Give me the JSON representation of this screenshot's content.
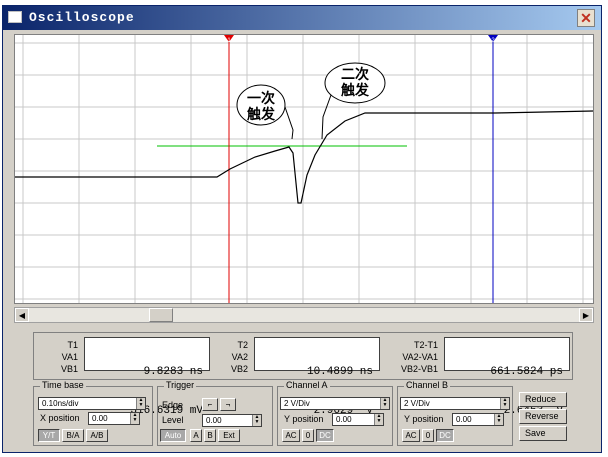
{
  "window": {
    "title": "Oscilloscope",
    "close_label": "✕"
  },
  "screen": {
    "annotation_first": [
      "一次",
      "触发"
    ],
    "annotation_second": [
      "二次",
      "触发"
    ],
    "cursor1_label": "1",
    "cursor2_label": "2",
    "colors": {
      "grid": "#c0c0c0",
      "trace": "#000000",
      "trigger_line": "#00c000",
      "cursor1": "#e00000",
      "cursor2": "#0000c0"
    }
  },
  "readouts": {
    "t1": {
      "labels": [
        "T1",
        "VA1",
        "VB1"
      ],
      "lines": [
        "9.8283 ns",
        "316.6319 mV"
      ]
    },
    "t2": {
      "labels": [
        "T2",
        "VA2",
        "VB2"
      ],
      "lines": [
        "10.4899 ns",
        "2.9629  V"
      ]
    },
    "delta": {
      "labels": [
        "T2-T1",
        "VA2-VA1",
        "VB2-VB1"
      ],
      "lines": [
        "661.5824 ps",
        "2.6463  V"
      ]
    }
  },
  "timebase": {
    "title": "Time base",
    "scale": "0.10ns/div",
    "xpos_label": "X position",
    "xpos": "0.00",
    "buttons": [
      "Y/T",
      "B/A",
      "A/B"
    ]
  },
  "trigger": {
    "title": "Trigger",
    "edge_label": "Edge",
    "level_label": "Level",
    "level": "0.00",
    "buttons": [
      "Auto",
      "A",
      "B",
      "Ext"
    ]
  },
  "channel_a": {
    "title": "Channel A",
    "scale": "2 V/Div",
    "ypos_label": "Y position",
    "ypos": "0.00",
    "buttons": [
      "AC",
      "0",
      "DC"
    ]
  },
  "channel_b": {
    "title": "Channel B",
    "scale": "2 V/Div",
    "ypos_label": "Y position",
    "ypos": "0.00",
    "buttons": [
      "AC",
      "0",
      "DC"
    ]
  },
  "side_buttons": {
    "reduce": "Reduce",
    "reverse": "Reverse",
    "save": "Save"
  }
}
